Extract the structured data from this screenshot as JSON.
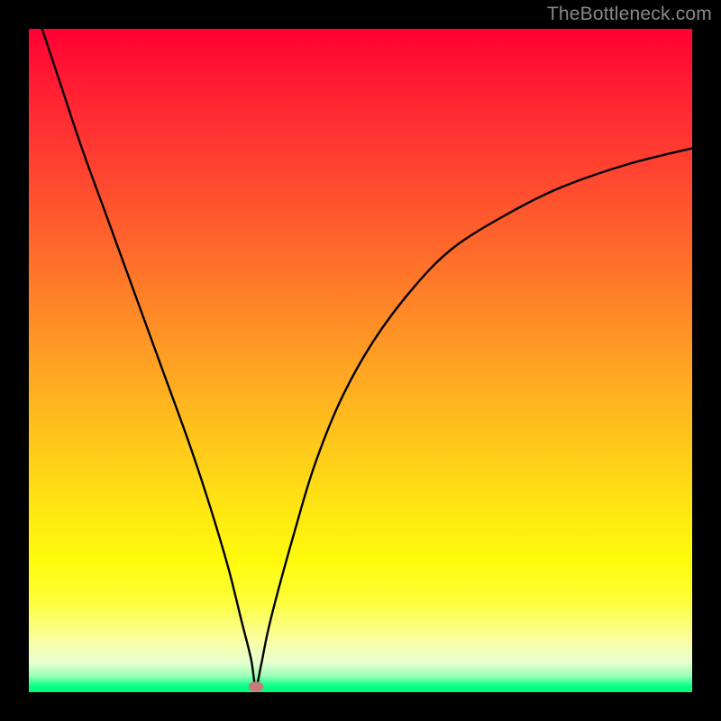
{
  "watermark": "TheBottleneck.com",
  "colors": {
    "frame": "#000000",
    "curve": "#000000",
    "marker": "#c97b78",
    "gradient_top": "#ff0033",
    "gradient_bottom": "#00ff7a"
  },
  "chart_data": {
    "type": "line",
    "title": "",
    "xlabel": "",
    "ylabel": "",
    "xlim": [
      0,
      100
    ],
    "ylim": [
      0,
      100
    ],
    "grid": false,
    "notes": "Bottleneck-style V curve. Minimum (optimal point) marked with a small rounded marker near the x-axis. No axis ticks or labels visible.",
    "marker": {
      "x": 34.2,
      "y": 0.8
    },
    "series": [
      {
        "name": "bottleneck-curve",
        "x": [
          2,
          5,
          8,
          12,
          16,
          20,
          24,
          27,
          30,
          32,
          33.5,
          34.2,
          35,
          36,
          37.5,
          40,
          43,
          47,
          52,
          58,
          64,
          72,
          80,
          90,
          100
        ],
        "values": [
          100,
          91,
          82,
          71,
          60,
          49,
          38,
          29,
          19,
          11,
          5,
          0.8,
          4,
          9,
          15,
          24,
          34,
          44,
          53,
          61,
          67,
          72,
          76,
          79.5,
          82
        ]
      }
    ]
  }
}
